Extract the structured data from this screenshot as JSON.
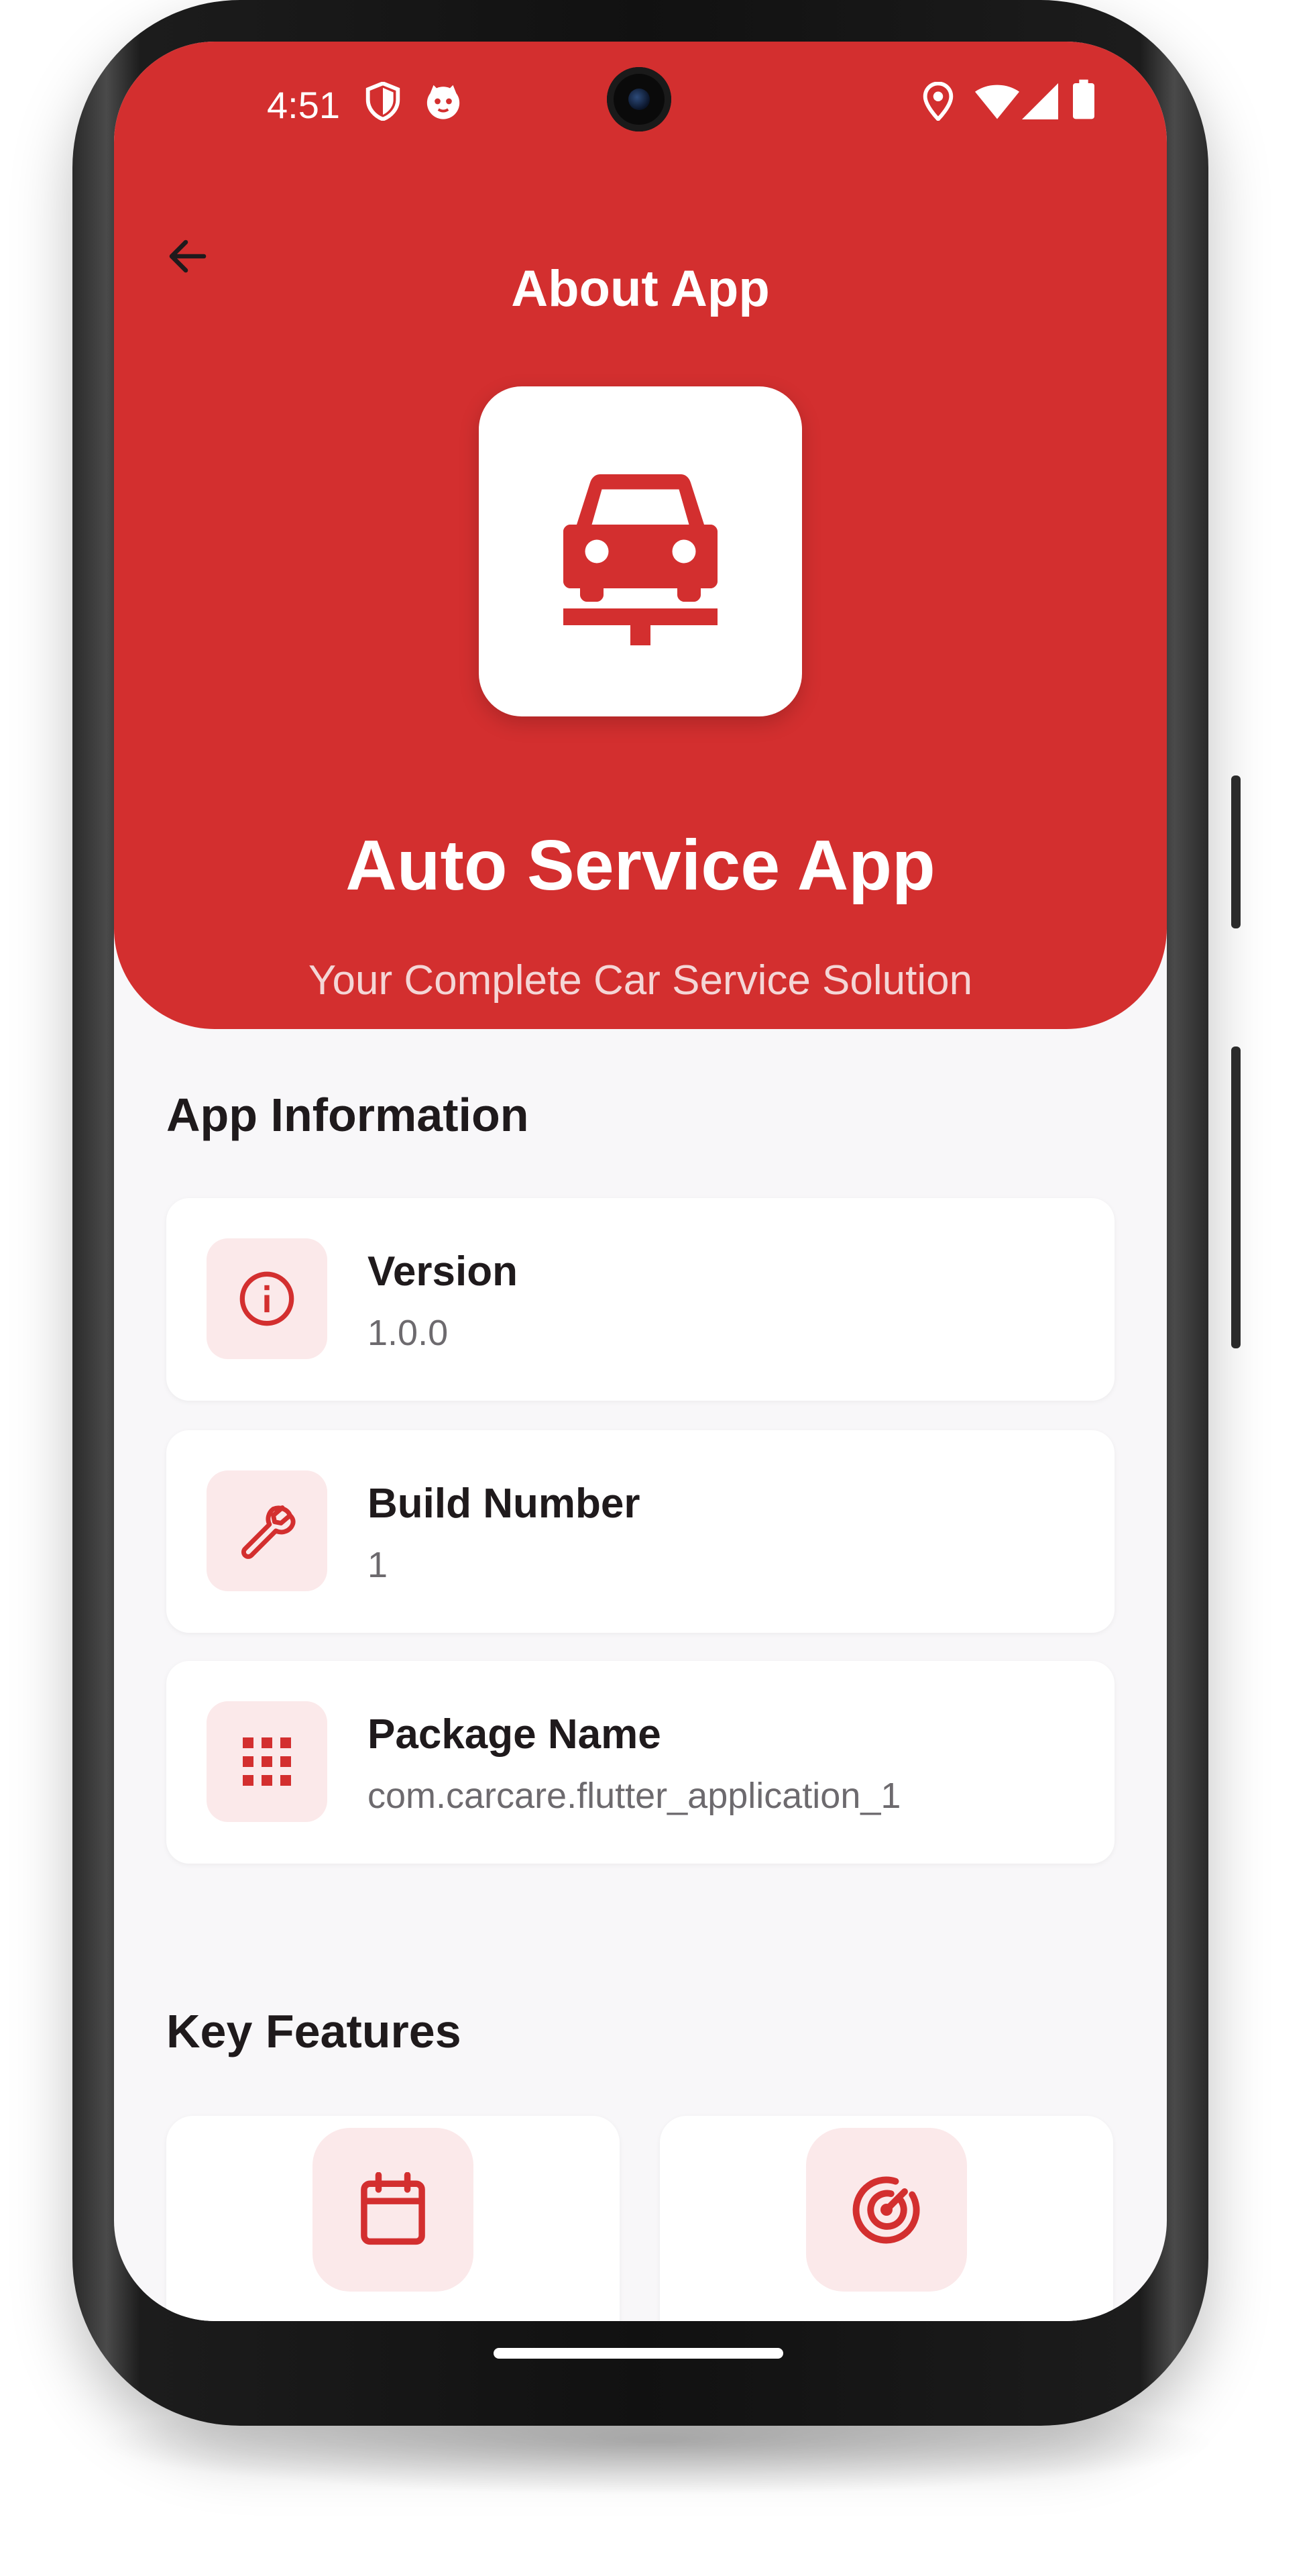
{
  "status_bar": {
    "time": "4:51",
    "left_icons": [
      "shield-icon",
      "cat-face-icon"
    ],
    "right_icons": [
      "location-icon",
      "wifi-icon",
      "signal-icon",
      "battery-icon"
    ]
  },
  "app_bar": {
    "title": "About App",
    "back_icon": "arrow-back-icon"
  },
  "hero": {
    "logo_icon": "car-lift-icon",
    "app_name": "Auto Service App",
    "tagline": "Your Complete Car Service Solution"
  },
  "app_information": {
    "title": "App Information",
    "items": [
      {
        "label": "Version",
        "value": "1.0.0",
        "icon": "info-icon"
      },
      {
        "label": "Build Number",
        "value": "1",
        "icon": "wrench-icon"
      },
      {
        "label": "Package Name",
        "value": "com.carcare.flutter_application_1",
        "icon": "apps-grid-icon"
      }
    ]
  },
  "key_features": {
    "title": "Key Features",
    "items": [
      {
        "icon": "calendar-icon"
      },
      {
        "icon": "radar-icon"
      }
    ]
  },
  "colors": {
    "primary": "#d32f2f",
    "icon_tile": "#fbe9ea",
    "background": "#f8f7f9",
    "text_primary": "#1f1a1c",
    "text_secondary": "#6d6a6e"
  }
}
